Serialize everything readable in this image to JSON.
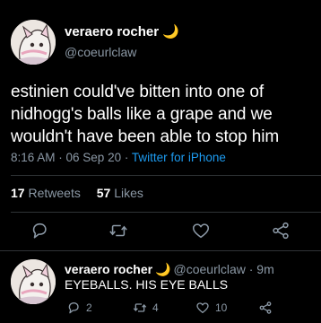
{
  "tweet": {
    "author_name": "veraero rocher",
    "author_emoji": "🌙",
    "handle": "@coeurlclaw",
    "text": "estinien could've bitten into one of nidhogg's balls like a grape and we wouldn't have been able to stop him",
    "timestamp": "8:16 AM · 06 Sep 20 · ",
    "source": "Twitter for iPhone",
    "retweets_count": "17",
    "retweets_label": "Retweets",
    "likes_count": "57",
    "likes_label": "Likes",
    "actions": [
      "reply-icon",
      "retweet-icon",
      "like-icon",
      "share-icon"
    ]
  },
  "reply": {
    "author_name": "veraero rocher",
    "author_emoji": "🌙",
    "handle": "@coeurlclaw",
    "time": "· 9m",
    "text": "EYEBALLS. HIS EYE BALLS",
    "reply_count": "2",
    "retweet_count": "4",
    "like_count": "10"
  },
  "colors": {
    "background": "#000000",
    "text": "#ffffff",
    "muted": "#8b98a5",
    "link": "#1d9bf0",
    "divider": "#2f3336"
  }
}
